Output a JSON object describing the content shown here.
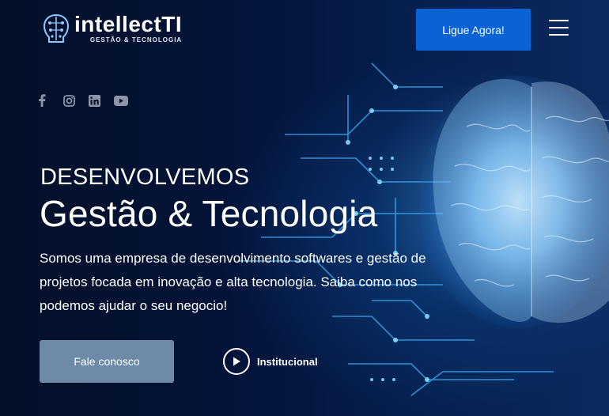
{
  "brand": {
    "name": "intellectTI",
    "tagline": "GESTÃO & TECNOLOGIA",
    "accent": "#0a63d6"
  },
  "header": {
    "call_label": "Ligue Agora!",
    "menu_icon": "hamburger-menu-icon"
  },
  "social": [
    {
      "icon": "facebook-icon"
    },
    {
      "icon": "instagram-icon"
    },
    {
      "icon": "linkedin-icon"
    },
    {
      "icon": "youtube-icon"
    }
  ],
  "hero": {
    "eyebrow": "DESENVOLVEMOS",
    "headline": "Gestão & Tecnologia",
    "description": "Somos uma empresa de desenvolvimento softwares e gestão de projetos focada em inovação e alta tecnologia. Saiba como nos podemos ajudar o seu negocio!",
    "cta_label": "Fale conosco",
    "video_label": "Institucional"
  },
  "colors": {
    "background": "#04102a",
    "cta_button": "#6d8ba8",
    "glow": "#7fd0ff"
  }
}
